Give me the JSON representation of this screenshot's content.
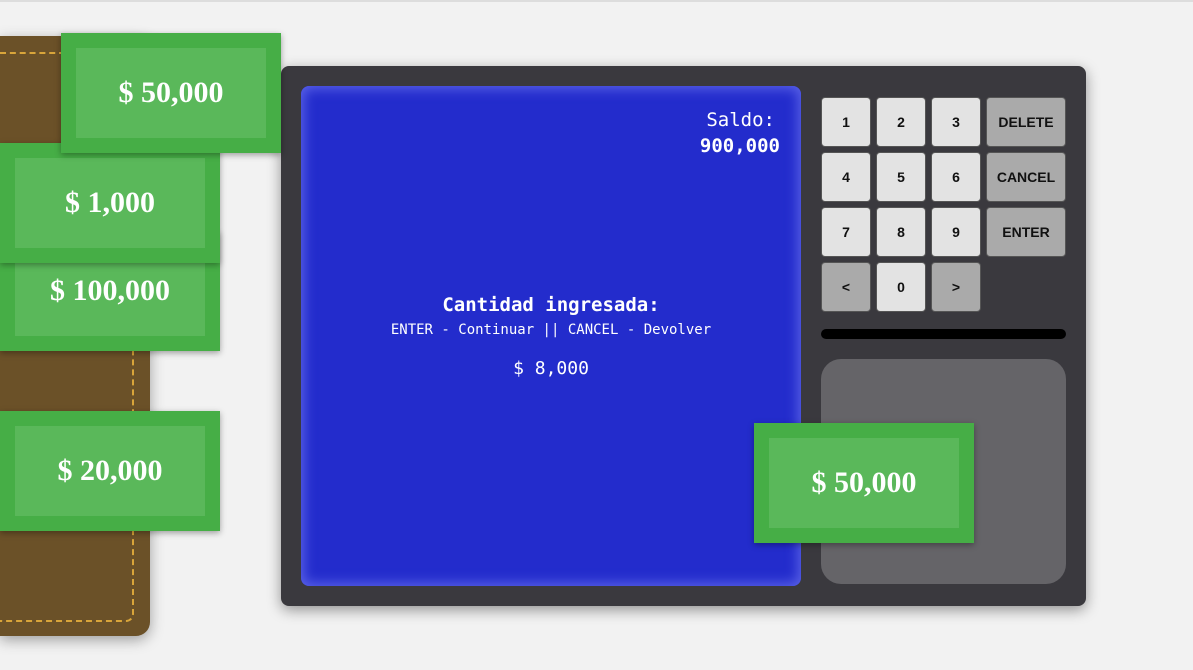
{
  "wallet": {
    "bills": [
      "$ 50,000",
      "$ 1,000",
      "$ 100,000",
      "$ 20,000"
    ]
  },
  "atm": {
    "screen": {
      "balance_label": "Saldo:",
      "balance_value": "900,000",
      "title": "Cantidad ingresada:",
      "instructions": "ENTER - Continuar || CANCEL - Devolver",
      "amount": "$ 8,000"
    },
    "keypad": {
      "keys": [
        "1",
        "2",
        "3",
        "DELETE",
        "4",
        "5",
        "6",
        "CANCEL",
        "7",
        "8",
        "9",
        "ENTER",
        "<",
        "0",
        ">"
      ]
    },
    "tray_bill": "$ 50,000"
  }
}
